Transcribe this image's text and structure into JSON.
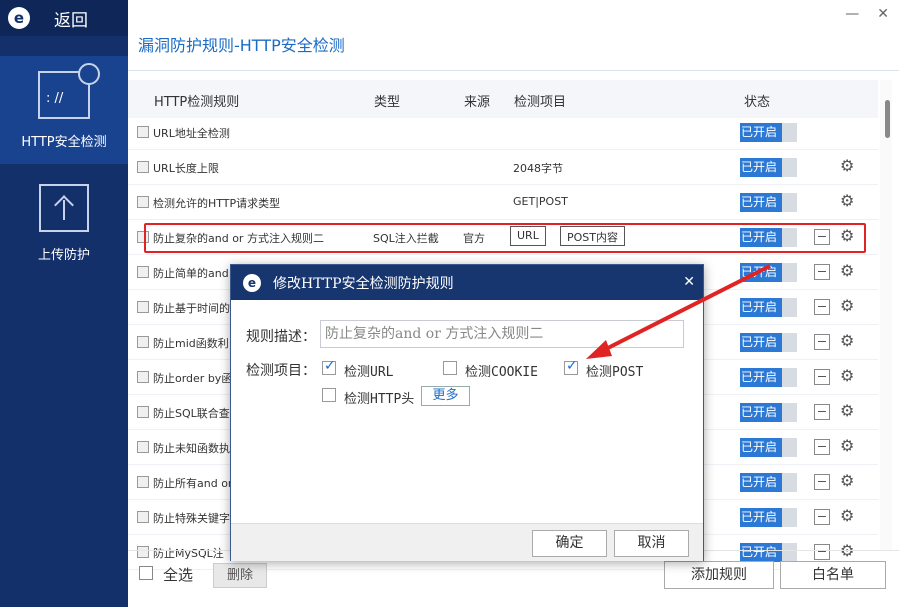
{
  "app": {
    "back_label": "返回",
    "logo_glyph": "e"
  },
  "sidebar": {
    "items": [
      {
        "label": "HTTP安全检测",
        "active": true
      },
      {
        "label": "上传防护",
        "active": false
      }
    ]
  },
  "window": {
    "minimize": "—",
    "close": "✕"
  },
  "page": {
    "title": "漏洞防护规则-HTTP安全检测"
  },
  "table": {
    "headers": [
      "HTTP检测规则",
      "类型",
      "来源",
      "检测项目",
      "状态"
    ],
    "rows": [
      {
        "name": "URL地址全检测",
        "type": "",
        "source": "",
        "check": "",
        "tags": [],
        "status": "已开启"
      },
      {
        "name": "URL长度上限",
        "type": "",
        "source": "",
        "check": "2048字节",
        "tags": [],
        "status": "已开启"
      },
      {
        "name": "检测允许的HTTP请求类型",
        "type": "",
        "source": "",
        "check": "GET|POST",
        "tags": [],
        "status": "已开启"
      },
      {
        "name": "防止复杂的and or 方式注入规则二",
        "type": "SQL注入拦截",
        "source": "官方",
        "check": "",
        "tags": [
          "URL",
          "POST内容"
        ],
        "status": "已开启"
      },
      {
        "name": "防止简单的and",
        "type": "",
        "source": "",
        "check": "",
        "tags": [],
        "status": "已开启"
      },
      {
        "name": "防止基于时间的",
        "type": "",
        "source": "",
        "check": "",
        "tags": [],
        "status": "已开启"
      },
      {
        "name": "防止mid函数利",
        "type": "",
        "source": "",
        "check": "",
        "tags": [],
        "status": "已开启"
      },
      {
        "name": "防止order by函",
        "type": "",
        "source": "",
        "check": "",
        "tags": [],
        "status": "已开启"
      },
      {
        "name": "防止SQL联合查",
        "type": "",
        "source": "",
        "check": "",
        "tags": [],
        "status": "已开启"
      },
      {
        "name": "防止未知函数执",
        "type": "",
        "source": "",
        "check": "",
        "tags": [],
        "status": "已开启"
      },
      {
        "name": "防止所有and or",
        "type": "",
        "source": "",
        "check": "",
        "tags": [],
        "status": "已开启"
      },
      {
        "name": "防止特殊关键字",
        "type": "",
        "source": "",
        "check": "",
        "tags": [],
        "status": "已开启"
      },
      {
        "name": "防止MySQL注",
        "type": "",
        "source": "",
        "check": "",
        "tags": [],
        "status": "已开启"
      }
    ],
    "gear_glyph": "⚙"
  },
  "footer": {
    "select_all": "全选",
    "delete": "删除",
    "add_rule": "添加规则",
    "whitelist": "白名单"
  },
  "dialog": {
    "title": "修改HTTP安全检测防护规则",
    "close": "✕",
    "desc_label": "规则描述：",
    "desc_value": "防止复杂的and or 方式注入规则二",
    "items_label": "检测项目：",
    "options": [
      {
        "label": "检测URL",
        "checked": true
      },
      {
        "label": "检测COOKIE",
        "checked": false
      },
      {
        "label": "检测POST",
        "checked": true
      },
      {
        "label": "检测HTTP头",
        "checked": false
      }
    ],
    "more": "更多",
    "ok": "确定",
    "cancel": "取消"
  },
  "colors": {
    "accent": "#1c6cc6",
    "sidebar": "#13306b",
    "highlight": "#e02424"
  }
}
